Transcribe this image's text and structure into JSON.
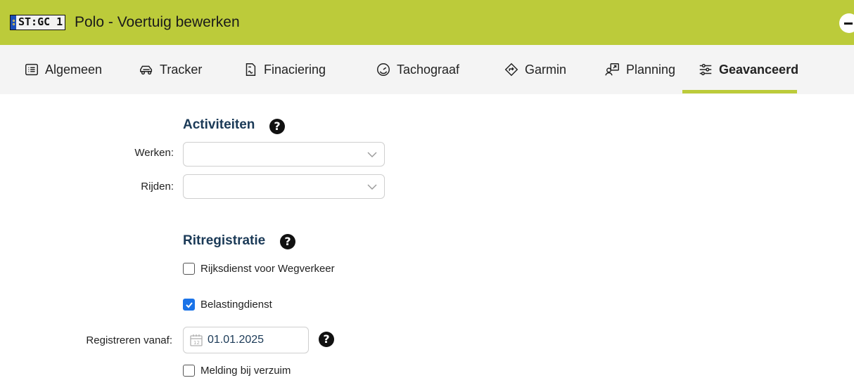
{
  "header": {
    "plate": "ST:GC 1",
    "title": "Polo - Voertuig bewerken",
    "accent_color": "#bccb3a"
  },
  "tabs": [
    {
      "label": "Algemeen",
      "icon": "list-icon"
    },
    {
      "label": "Tracker",
      "icon": "car-icon"
    },
    {
      "label": "Finaciering",
      "icon": "document-icon"
    },
    {
      "label": "Tachograaf",
      "icon": "gauge-icon"
    },
    {
      "label": "Garmin",
      "icon": "navigation-icon"
    },
    {
      "label": "Planning",
      "icon": "planning-icon"
    },
    {
      "label": "Geavanceerd",
      "icon": "sliders-icon",
      "active": true
    }
  ],
  "activiteiten": {
    "title": "Activiteiten",
    "werken_label": "Werken:",
    "werken_value": "",
    "rijden_label": "Rijden:",
    "rijden_value": ""
  },
  "ritregistratie": {
    "title": "Ritregistratie",
    "rdw_label": "Rijksdienst voor Wegverkeer",
    "rdw_checked": false,
    "belasting_label": "Belastingdienst",
    "belasting_checked": true,
    "registreren_label": "Registreren vanaf:",
    "registreren_value": "01.01.2025",
    "melding_label": "Melding bij verzuim",
    "melding_checked": false
  },
  "help_glyph": "?"
}
